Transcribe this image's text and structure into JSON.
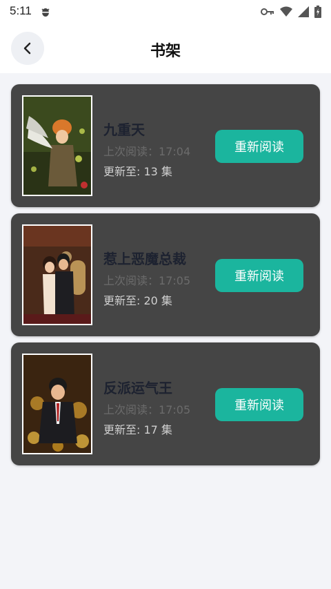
{
  "status_bar": {
    "time": "5:11"
  },
  "header": {
    "title": "书架"
  },
  "labels": {
    "last_read_prefix": "上次阅读：",
    "updated_prefix": "更新至: ",
    "episode_suffix": " 集"
  },
  "books": [
    {
      "title": "九重天",
      "last_read_time": "17:04",
      "updated_label": "更新至: 13 集",
      "button_label": "重新阅读",
      "cover_title": "九重天"
    },
    {
      "title": "惹上恶魔总裁",
      "last_read_time": "17:05",
      "updated_label": "更新至: 20 集",
      "button_label": "重新阅读",
      "cover_title": "惹上恶魔总裁"
    },
    {
      "title": "反派运气王",
      "last_read_time": "17:05",
      "updated_label": "更新至: 17 集",
      "button_label": "重新阅读",
      "cover_title": "反派运气王"
    }
  ],
  "colors": {
    "accent": "#1bb59e",
    "card_bg": "#454545",
    "page_bg": "#f3f4f8"
  }
}
